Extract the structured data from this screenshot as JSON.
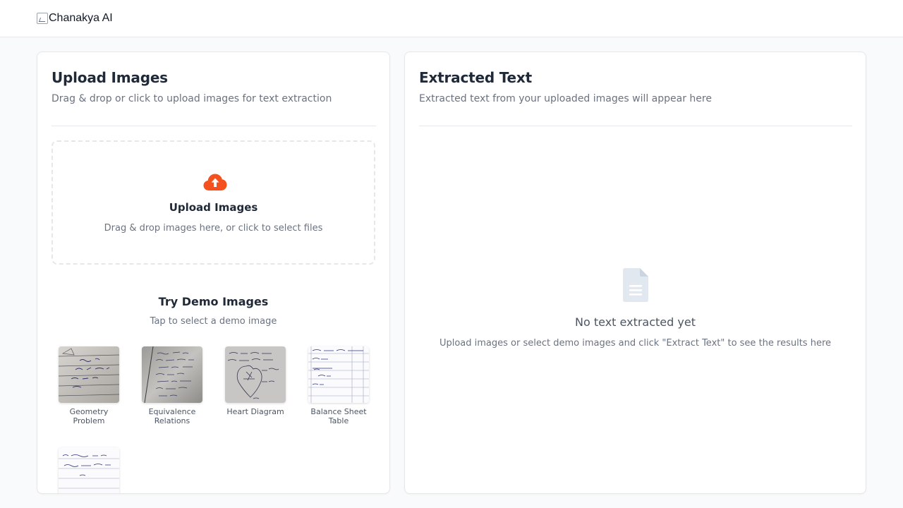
{
  "header": {
    "logo_alt": "Chanakya AI"
  },
  "upload_panel": {
    "title": "Upload Images",
    "subtitle": "Drag & drop or click to upload images for text extraction",
    "dropzone": {
      "icon": "cloud-upload-icon",
      "title": "Upload Images",
      "subtitle": "Drag & drop images here, or click to select files"
    },
    "demo": {
      "title": "Try Demo Images",
      "subtitle": "Tap to select a demo image",
      "items": [
        {
          "label": "Geometry Problem"
        },
        {
          "label": "Equivalence Relations"
        },
        {
          "label": "Heart Diagram"
        },
        {
          "label": "Balance Sheet Table"
        },
        {
          "label": ""
        }
      ]
    }
  },
  "result_panel": {
    "title": "Extracted Text",
    "subtitle": "Extracted text from your uploaded images will appear here",
    "empty_state": {
      "icon": "document-icon",
      "title": "No text extracted yet",
      "subtitle": "Upload images or select demo images and click \"Extract Text\" to see the results here"
    }
  },
  "colors": {
    "accent": "#f5511e",
    "border": "#e5e7eb",
    "muted_text": "#6b7280",
    "heading_text": "#1f2937",
    "icon_placeholder": "#e2e8f0"
  }
}
